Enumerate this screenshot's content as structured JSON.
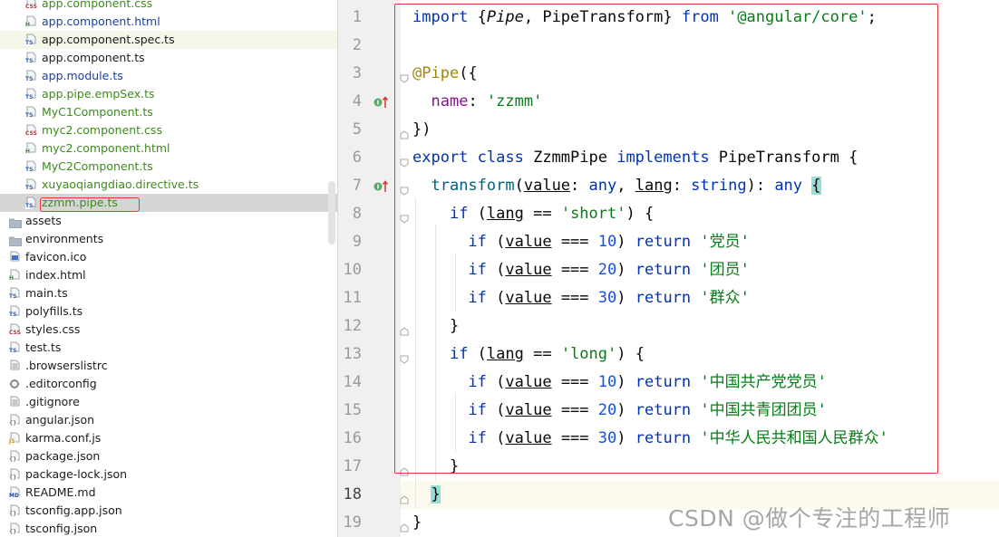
{
  "colors": {
    "file_green": "#3d8b1b",
    "file_blue": "#1a3fa8",
    "file_black": "#1b1b1b",
    "highlight_red": "#e53935",
    "selected_row": "#d5d5d5",
    "current_line": "#fcfaed"
  },
  "project_tree": {
    "items": [
      {
        "name": "app.component.css",
        "icon": "css-file-icon",
        "color": "green",
        "indent": 28
      },
      {
        "name": "app.component.html",
        "icon": "html-file-icon",
        "color": "blue",
        "indent": 28
      },
      {
        "name": "app.component.spec.ts",
        "icon": "ts-test-file-icon",
        "color": "black",
        "indent": 28,
        "spec": true
      },
      {
        "name": "app.component.ts",
        "icon": "ts-file-icon",
        "color": "black",
        "indent": 28
      },
      {
        "name": "app.module.ts",
        "icon": "ts-file-icon",
        "color": "blue",
        "indent": 28
      },
      {
        "name": "app.pipe.empSex.ts",
        "icon": "ts-file-icon",
        "color": "green",
        "indent": 28
      },
      {
        "name": "MyC1Component.ts",
        "icon": "ts-file-icon",
        "color": "green",
        "indent": 28
      },
      {
        "name": "myc2.component.css",
        "icon": "css-file-icon",
        "color": "green",
        "indent": 28
      },
      {
        "name": "myc2.component.html",
        "icon": "html-file-icon",
        "color": "green",
        "indent": 28
      },
      {
        "name": "MyC2Component.ts",
        "icon": "ts-file-icon",
        "color": "green",
        "indent": 28
      },
      {
        "name": "xuyaoqiangdiao.directive.ts",
        "icon": "ts-file-icon",
        "color": "green",
        "indent": 28
      },
      {
        "name": "zzmm.pipe.ts",
        "icon": "ts-file-icon",
        "color": "green",
        "indent": 28,
        "selected": true
      },
      {
        "name": "assets",
        "icon": "folder-icon",
        "color": "black",
        "indent": 10
      },
      {
        "name": "environments",
        "icon": "folder-icon",
        "color": "black",
        "indent": 10
      },
      {
        "name": "favicon.ico",
        "icon": "image-file-icon",
        "color": "black",
        "indent": 10
      },
      {
        "name": "index.html",
        "icon": "html-file-icon",
        "color": "black",
        "indent": 10
      },
      {
        "name": "main.ts",
        "icon": "ts-file-icon",
        "color": "black",
        "indent": 10
      },
      {
        "name": "polyfills.ts",
        "icon": "ts-file-icon",
        "color": "black",
        "indent": 10
      },
      {
        "name": "styles.css",
        "icon": "css-file-icon",
        "color": "black",
        "indent": 10
      },
      {
        "name": "test.ts",
        "icon": "ts-file-icon",
        "color": "black",
        "indent": 10
      },
      {
        "name": ".browserslistrc",
        "icon": "text-file-icon",
        "color": "black",
        "indent": 10
      },
      {
        "name": ".editorconfig",
        "icon": "config-gear-icon",
        "color": "black",
        "indent": 10
      },
      {
        "name": ".gitignore",
        "icon": "text-file-icon",
        "color": "black",
        "indent": 10
      },
      {
        "name": "angular.json",
        "icon": "json-file-icon",
        "color": "black",
        "indent": 10
      },
      {
        "name": "karma.conf.js",
        "icon": "js-file-icon",
        "color": "black",
        "indent": 10
      },
      {
        "name": "package.json",
        "icon": "json-file-icon",
        "color": "black",
        "indent": 10
      },
      {
        "name": "package-lock.json",
        "icon": "json-file-icon",
        "color": "black",
        "indent": 10
      },
      {
        "name": "README.md",
        "icon": "markdown-file-icon",
        "color": "black",
        "indent": 10
      },
      {
        "name": "tsconfig.app.json",
        "icon": "json-file-icon",
        "color": "black",
        "indent": 10
      },
      {
        "name": "tsconfig.json",
        "icon": "json-file-icon",
        "color": "black",
        "indent": 10
      }
    ]
  },
  "editor": {
    "line_numbers": [
      "1",
      "2",
      "3",
      "4",
      "5",
      "6",
      "7",
      "8",
      "9",
      "10",
      "11",
      "12",
      "13",
      "14",
      "15",
      "16",
      "17",
      "18",
      "19"
    ],
    "current_line": "18",
    "lines": [
      [
        {
          "t": "import ",
          "c": "kw"
        },
        {
          "t": "{"
        },
        {
          "t": "Pipe",
          "c": "ital"
        },
        {
          "t": ", PipeTransform} "
        },
        {
          "t": "from ",
          "c": "kw"
        },
        {
          "t": "'@angular/core'",
          "c": "str"
        },
        {
          "t": ";"
        }
      ],
      [],
      [
        {
          "t": "@Pipe",
          "c": "ann"
        },
        {
          "t": "({"
        }
      ],
      [
        {
          "t": "  "
        },
        {
          "t": "name",
          "c": "prop"
        },
        {
          "t": ": "
        },
        {
          "t": "'zzmm'",
          "c": "str"
        }
      ],
      [
        {
          "t": "})"
        }
      ],
      [
        {
          "t": "export ",
          "c": "kw"
        },
        {
          "t": "class ",
          "c": "kw"
        },
        {
          "t": "ZzmmPipe "
        },
        {
          "t": "implements ",
          "c": "kw"
        },
        {
          "t": "PipeTransform {"
        }
      ],
      [
        {
          "t": "  "
        },
        {
          "t": "transform",
          "c": "fn"
        },
        {
          "t": "("
        },
        {
          "t": "value",
          "c": "ul"
        },
        {
          "t": ": "
        },
        {
          "t": "any",
          "c": "kw"
        },
        {
          "t": ", "
        },
        {
          "t": "lang",
          "c": "ul"
        },
        {
          "t": ": "
        },
        {
          "t": "string",
          "c": "kw"
        },
        {
          "t": "): "
        },
        {
          "t": "any",
          "c": "kw"
        },
        {
          "t": " "
        },
        {
          "t": "{",
          "c": "brk-hl"
        }
      ],
      [
        {
          "t": "    "
        },
        {
          "t": "if",
          "c": "kw"
        },
        {
          "t": " ("
        },
        {
          "t": "lang",
          "c": "ul"
        },
        {
          "t": " == "
        },
        {
          "t": "'short'",
          "c": "str"
        },
        {
          "t": ") {"
        }
      ],
      [
        {
          "t": "      "
        },
        {
          "t": "if",
          "c": "kw"
        },
        {
          "t": " ("
        },
        {
          "t": "value",
          "c": "ul"
        },
        {
          "t": " === "
        },
        {
          "t": "10",
          "c": "num"
        },
        {
          "t": ") "
        },
        {
          "t": "return ",
          "c": "kw"
        },
        {
          "t": "'党员'",
          "c": "str"
        }
      ],
      [
        {
          "t": "      "
        },
        {
          "t": "if",
          "c": "kw"
        },
        {
          "t": " ("
        },
        {
          "t": "value",
          "c": "ul"
        },
        {
          "t": " === "
        },
        {
          "t": "20",
          "c": "num"
        },
        {
          "t": ") "
        },
        {
          "t": "return ",
          "c": "kw"
        },
        {
          "t": "'团员'",
          "c": "str"
        }
      ],
      [
        {
          "t": "      "
        },
        {
          "t": "if",
          "c": "kw"
        },
        {
          "t": " ("
        },
        {
          "t": "value",
          "c": "ul"
        },
        {
          "t": " === "
        },
        {
          "t": "30",
          "c": "num"
        },
        {
          "t": ") "
        },
        {
          "t": "return ",
          "c": "kw"
        },
        {
          "t": "'群众'",
          "c": "str"
        }
      ],
      [
        {
          "t": "    }"
        }
      ],
      [
        {
          "t": "    "
        },
        {
          "t": "if",
          "c": "kw"
        },
        {
          "t": " ("
        },
        {
          "t": "lang",
          "c": "ul"
        },
        {
          "t": " == "
        },
        {
          "t": "'long'",
          "c": "str"
        },
        {
          "t": ") {"
        }
      ],
      [
        {
          "t": "      "
        },
        {
          "t": "if",
          "c": "kw"
        },
        {
          "t": " ("
        },
        {
          "t": "value",
          "c": "ul"
        },
        {
          "t": " === "
        },
        {
          "t": "10",
          "c": "num"
        },
        {
          "t": ") "
        },
        {
          "t": "return ",
          "c": "kw"
        },
        {
          "t": "'中国共产党党员'",
          "c": "str"
        }
      ],
      [
        {
          "t": "      "
        },
        {
          "t": "if",
          "c": "kw"
        },
        {
          "t": " ("
        },
        {
          "t": "value",
          "c": "ul"
        },
        {
          "t": " === "
        },
        {
          "t": "20",
          "c": "num"
        },
        {
          "t": ") "
        },
        {
          "t": "return ",
          "c": "kw"
        },
        {
          "t": "'中国共青团团员'",
          "c": "str"
        }
      ],
      [
        {
          "t": "      "
        },
        {
          "t": "if",
          "c": "kw"
        },
        {
          "t": " ("
        },
        {
          "t": "value",
          "c": "ul"
        },
        {
          "t": " === "
        },
        {
          "t": "30",
          "c": "num"
        },
        {
          "t": ") "
        },
        {
          "t": "return ",
          "c": "kw"
        },
        {
          "t": "'中华人民共和国人民群众'",
          "c": "str"
        }
      ],
      [
        {
          "t": "    }"
        }
      ],
      [
        {
          "t": "  "
        },
        {
          "t": "}",
          "c": "brk-hl"
        }
      ],
      [
        {
          "t": "}"
        }
      ]
    ]
  },
  "watermark": "CSDN @做个专注的工程师"
}
